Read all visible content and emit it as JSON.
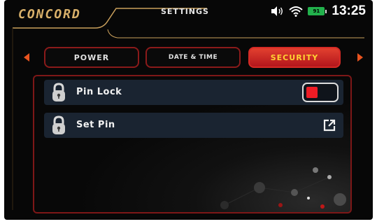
{
  "header": {
    "logo": "CONCORD",
    "title": "SETTINGS",
    "status": {
      "volume_icon": "speaker-icon",
      "wifi_icon": "wifi-icon",
      "battery_level": "91",
      "time": "13:25"
    }
  },
  "tabs": [
    {
      "label": "POWER",
      "active": false
    },
    {
      "label": "DATE & TIME",
      "active": false
    },
    {
      "label": "SECURITY",
      "active": true
    }
  ],
  "nav": {
    "prev_icon": "chevron-left-icon",
    "next_icon": "chevron-right-icon"
  },
  "security": {
    "rows": [
      {
        "label": "Pin Lock",
        "icon": "padlock-icon",
        "control": "toggle",
        "toggle_state": "off"
      },
      {
        "label": "Set Pin",
        "icon": "padlock-icon",
        "control": "external-link-icon"
      }
    ]
  },
  "colors": {
    "accent_red": "#d52a25",
    "active_tab_text": "#ffd233",
    "nav_arrow": "#e8531f",
    "logo_gold": "#d8b06a",
    "row_bg": "#1a2431",
    "toggle_knob": "#ee1c25",
    "battery_green": "#22b14c"
  }
}
